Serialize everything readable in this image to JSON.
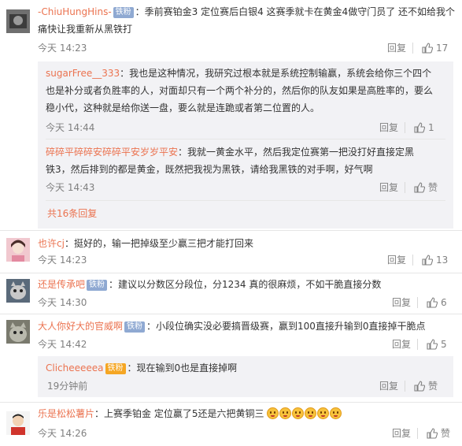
{
  "colors": {
    "username": "#eb7350",
    "meta": "#808080",
    "reply_bg": "#f2f2f5",
    "badge": "#8fa9d2"
  },
  "comments": [
    {
      "username": "-ChiuHungHins-",
      "badge": "铁粉",
      "text_line1": "：季前赛铂金3 定位赛后白银4 这赛季就卡在黄金4做守门员了 还不如给我个",
      "text_line2": "痛快让我重新从黑铁打",
      "time": "今天 14:23",
      "reply_label": "回复",
      "likes": "17",
      "replies": [
        {
          "username": "sugarFree__333",
          "text_line1": "：我也是这种情况，我研究过根本就是系统控制输赢，系统会给你三个四个",
          "text_line2": "也是补分或者负胜率的人，对面却只有一个两个补分的，然后你的队友如果是高胜率的，要么",
          "text_line3": "稳小代，这种就是给你送一盘，要么就是连跪或者第二位置的人。",
          "time": "今天 14:44",
          "reply_label": "回复",
          "likes": "1"
        },
        {
          "username": "碎碎平碎碎安碎碎平安岁岁平安",
          "text_line1": "：我就一黄金水平，然后我定位赛第一把没打好直接定黑",
          "text_line2": "铁3，然后排到的都是黄金，既然把我视为黑铁，请给我黑铁的对手啊，好气啊",
          "time": "今天 14:43",
          "reply_label": "回复",
          "likes": "赞"
        }
      ],
      "more_replies": "共16条回复"
    },
    {
      "username": "也许cj",
      "text": "：挺好的，输一把掉级至少赢三把才能打回来",
      "time": "今天 14:23",
      "reply_label": "回复",
      "likes": "13"
    },
    {
      "username": "还是传承吧",
      "badge": "铁粉",
      "text": "：建议以分数区分段位，分1234 真的很麻烦，不如干脆直接分数",
      "time": "今天 14:30",
      "reply_label": "回复",
      "likes": "6"
    },
    {
      "username": "大人你好大的官威啊",
      "badge": "铁粉",
      "text": "：小段位确实没必要搞晋级赛，赢到100直接升输到0直接掉干脆点",
      "time": "今天 14:42",
      "reply_label": "回复",
      "likes": "5",
      "replies": [
        {
          "username": "Clicheeeeea",
          "badge": "铁粉",
          "text": "：现在输到0也是直接掉啊",
          "time": "19分钟前",
          "reply_label": "回复",
          "likes": "赞"
        }
      ]
    },
    {
      "username": "乐是松松薯片",
      "text": "：上赛季铂金 定位赢了5还是六把黄铜三",
      "time": "今天 14:26",
      "reply_label": "回复",
      "likes": "赞"
    }
  ]
}
